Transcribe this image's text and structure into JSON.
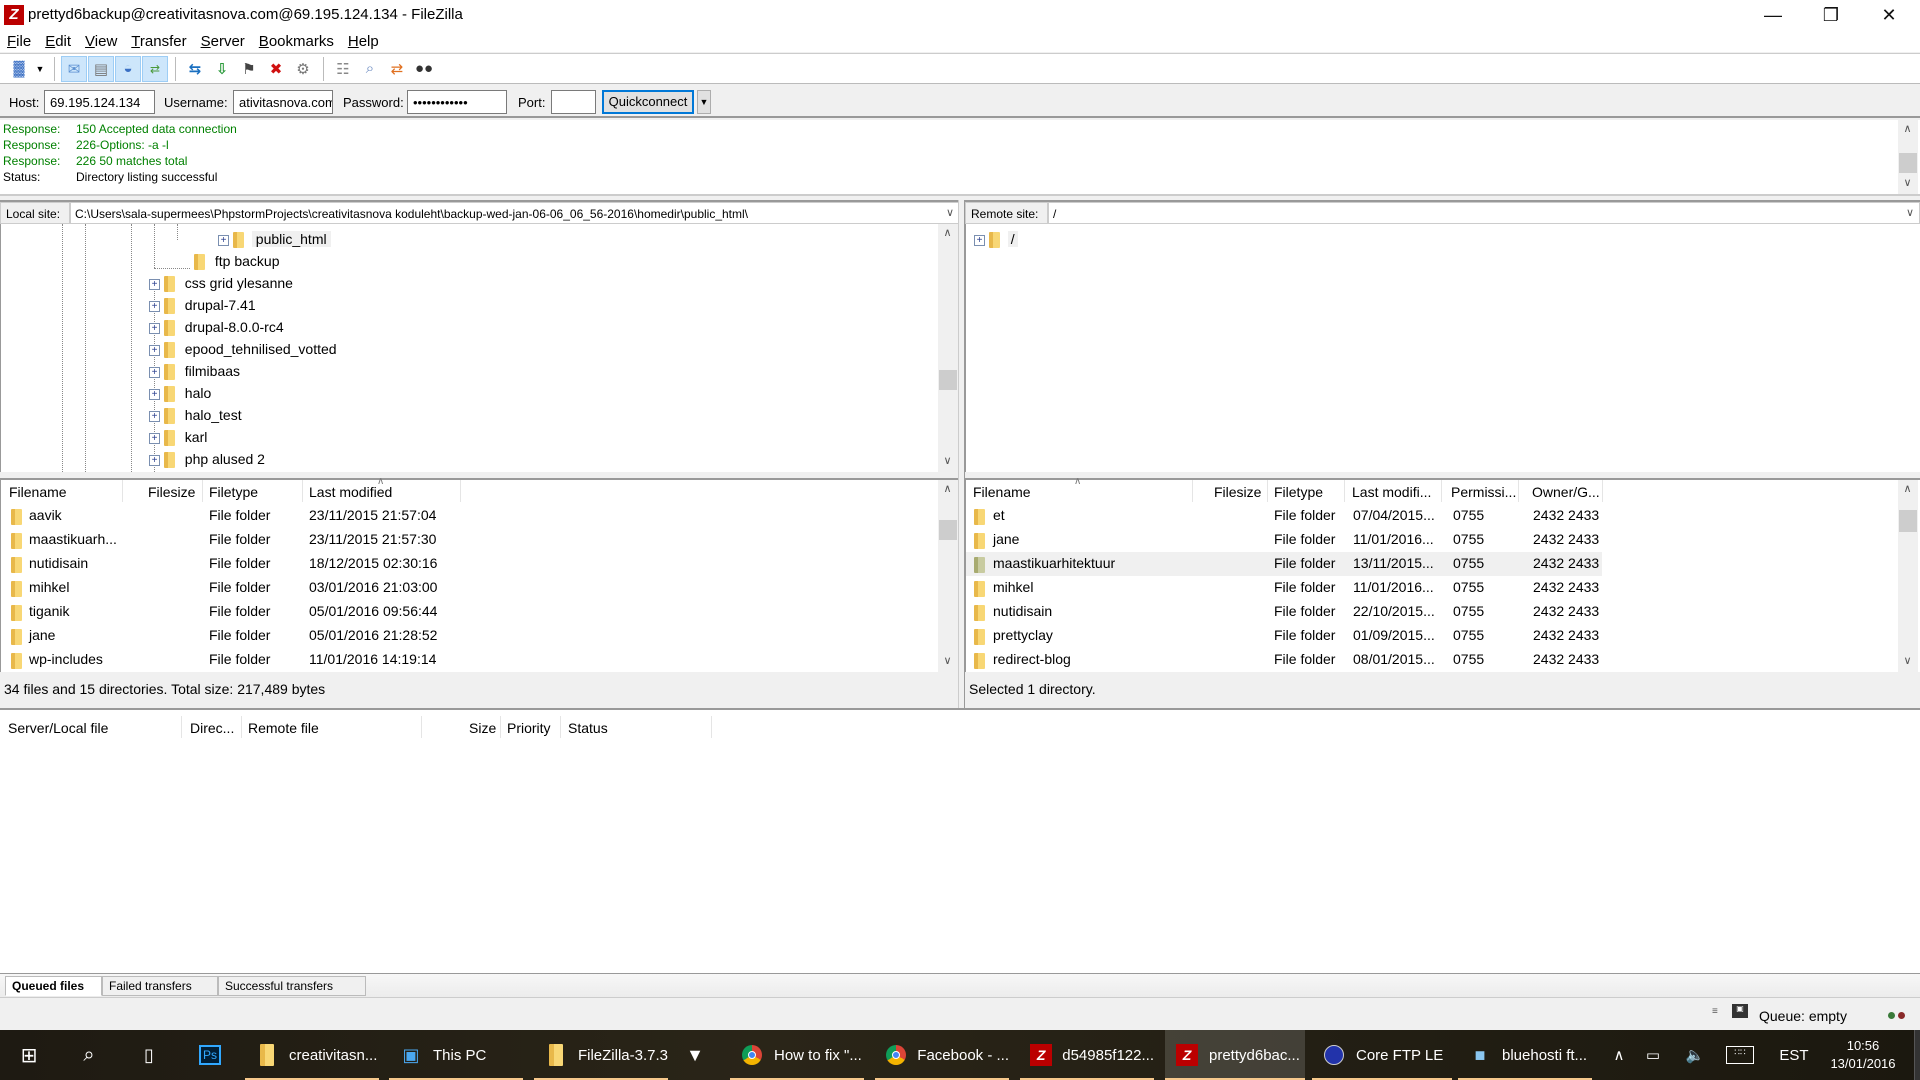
{
  "window": {
    "title": "prettyd6backup@creativitasnova.com@69.195.124.134 - FileZilla",
    "app_icon": "filezilla-icon",
    "controls": [
      "minimize-icon",
      "restore-icon",
      "close-icon"
    ]
  },
  "menu": [
    {
      "label": "File",
      "accel": "F",
      "rest": "ile"
    },
    {
      "label": "Edit",
      "accel": "E",
      "rest": "dit"
    },
    {
      "label": "View",
      "accel": "V",
      "rest": "iew"
    },
    {
      "label": "Transfer",
      "accel": "T",
      "rest": "ransfer"
    },
    {
      "label": "Server",
      "accel": "S",
      "rest": "erver"
    },
    {
      "label": "Bookmarks",
      "accel": "B",
      "rest": "ookmarks"
    },
    {
      "label": "Help",
      "accel": "H",
      "rest": "elp"
    }
  ],
  "toolbar": {
    "icons": [
      "site-manager-icon",
      "dropdown-arrow-icon",
      "toggle-message-log-icon",
      "toggle-local-tree-icon",
      "toggle-remote-tree-icon",
      "toggle-transfer-queue-icon",
      "refresh-icon",
      "process-queue-icon",
      "cancel-operation-icon",
      "disconnect-icon",
      "reconnect-icon",
      "directory-filter-icon",
      "toggle-comparison-icon",
      "sync-browsing-icon",
      "search-remote-icon"
    ]
  },
  "quickconnect": {
    "host_label": "Host:",
    "host_value": "69.195.124.134",
    "username_label": "Username:",
    "username_value": "ativitasnova.com",
    "password_label": "Password:",
    "password_value": "••••••••••••",
    "port_label": "Port:",
    "port_value": "",
    "button_label": "Quickconnect"
  },
  "log": [
    {
      "kind": "Response:",
      "text": "150 Accepted data connection",
      "color": "#008000"
    },
    {
      "kind": "Response:",
      "text": "226-Options: -a -l",
      "color": "#008000"
    },
    {
      "kind": "Response:",
      "text": "226 50 matches total",
      "color": "#008000"
    },
    {
      "kind": "Status:",
      "text": "Directory listing successful",
      "color": "#000000"
    }
  ],
  "local": {
    "site_label": "Local site:",
    "path": "C:\\Users\\sala-supermees\\PhpstormProjects\\creativitasnova koduleht\\backup-wed-jan-06-06_06_56-2016\\homedir\\public_html\\",
    "tree": [
      {
        "name": "public_html",
        "expandable": true,
        "selected": true
      },
      {
        "name": "ftp backup",
        "expandable": false
      },
      {
        "name": "css grid ylesanne",
        "expandable": true
      },
      {
        "name": "drupal-7.41",
        "expandable": true
      },
      {
        "name": "drupal-8.0.0-rc4",
        "expandable": true
      },
      {
        "name": "epood_tehnilised_votted",
        "expandable": true
      },
      {
        "name": "filmibaas",
        "expandable": true
      },
      {
        "name": "halo",
        "expandable": true
      },
      {
        "name": "halo_test",
        "expandable": true
      },
      {
        "name": "karl",
        "expandable": true
      },
      {
        "name": "php alused 2",
        "expandable": true
      }
    ],
    "columns": [
      "Filename",
      "Filesize",
      "Filetype",
      "Last modified"
    ],
    "files": [
      {
        "name": "aavik",
        "size": "",
        "type": "File folder",
        "modified": "23/11/2015 21:57:04"
      },
      {
        "name": "maastikuarh...",
        "size": "",
        "type": "File folder",
        "modified": "23/11/2015 21:57:30"
      },
      {
        "name": "nutidisain",
        "size": "",
        "type": "File folder",
        "modified": "18/12/2015 02:30:16"
      },
      {
        "name": "mihkel",
        "size": "",
        "type": "File folder",
        "modified": "03/01/2016 21:03:00"
      },
      {
        "name": "tiganik",
        "size": "",
        "type": "File folder",
        "modified": "05/01/2016 09:56:44"
      },
      {
        "name": "jane",
        "size": "",
        "type": "File folder",
        "modified": "05/01/2016 21:28:52"
      },
      {
        "name": "wp-includes",
        "size": "",
        "type": "File folder",
        "modified": "11/01/2016 14:19:14"
      }
    ],
    "status": "34 files and 15 directories. Total size: 217,489 bytes"
  },
  "remote": {
    "site_label": "Remote site:",
    "path": "/",
    "tree": [
      {
        "name": "/",
        "expandable": true
      }
    ],
    "columns": [
      "Filename",
      "Filesize",
      "Filetype",
      "Last modifi...",
      "Permissi...",
      "Owner/G..."
    ],
    "files": [
      {
        "name": "et",
        "size": "",
        "type": "File folder",
        "modified": "07/04/2015...",
        "perm": "0755",
        "owner": "2432 2433",
        "selected": false
      },
      {
        "name": "jane",
        "size": "",
        "type": "File folder",
        "modified": "11/01/2016...",
        "perm": "0755",
        "owner": "2432 2433",
        "selected": false
      },
      {
        "name": "maastikuarhitektuur",
        "size": "",
        "type": "File folder",
        "modified": "13/11/2015...",
        "perm": "0755",
        "owner": "2432 2433",
        "selected": true
      },
      {
        "name": "mihkel",
        "size": "",
        "type": "File folder",
        "modified": "11/01/2016...",
        "perm": "0755",
        "owner": "2432 2433",
        "selected": false
      },
      {
        "name": "nutidisain",
        "size": "",
        "type": "File folder",
        "modified": "22/10/2015...",
        "perm": "0755",
        "owner": "2432 2433",
        "selected": false
      },
      {
        "name": "prettyclay",
        "size": "",
        "type": "File folder",
        "modified": "01/09/2015...",
        "perm": "0755",
        "owner": "2432 2433",
        "selected": false
      },
      {
        "name": "redirect-blog",
        "size": "",
        "type": "File folder",
        "modified": "08/01/2015...",
        "perm": "0755",
        "owner": "2432 2433",
        "selected": false
      }
    ],
    "status": "Selected 1 directory."
  },
  "queue": {
    "columns": [
      "Server/Local file",
      "Direc...",
      "Remote file",
      "Size",
      "Priority",
      "Status"
    ],
    "tabs": [
      {
        "label": "Queued files",
        "active": true
      },
      {
        "label": "Failed transfers",
        "active": false
      },
      {
        "label": "Successful transfers",
        "active": false
      }
    ],
    "status_text": "Queue: empty"
  },
  "taskbar": {
    "items": [
      {
        "label": "",
        "icon": "windows-start-icon"
      },
      {
        "label": "",
        "icon": "search-icon"
      },
      {
        "label": "",
        "icon": "task-view-icon"
      },
      {
        "label": "",
        "icon": "photoshop-icon"
      },
      {
        "label": "creativitasn...",
        "icon": "folder-icon"
      },
      {
        "label": "This PC",
        "icon": "this-pc-icon"
      },
      {
        "label": "FileZilla-3.7.3",
        "icon": "folder-icon"
      },
      {
        "label": "",
        "icon": "foxhead-icon"
      },
      {
        "label": "How to fix \"...",
        "icon": "chrome-icon"
      },
      {
        "label": "Facebook - ...",
        "icon": "chrome-icon"
      },
      {
        "label": "d54985f122...",
        "icon": "filezilla-icon"
      },
      {
        "label": "prettyd6bac...",
        "icon": "filezilla-icon"
      },
      {
        "label": "Core FTP LE",
        "icon": "coreftp-icon"
      },
      {
        "label": "bluehosti ft...",
        "icon": "notepad-icon"
      }
    ],
    "tray": {
      "language": "EST",
      "time": "10:56",
      "date": "13/01/2016"
    }
  }
}
